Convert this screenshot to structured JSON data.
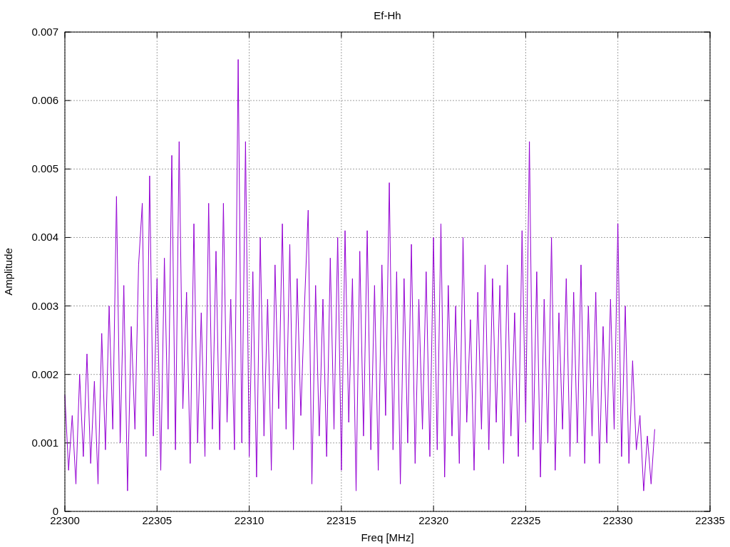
{
  "chart": {
    "chart_data": {
      "type": "line",
      "title": "Ef-Hh",
      "xlabel": "Freq [MHz]",
      "ylabel": "Amplitude",
      "grid": true,
      "xlim": [
        22300,
        22335
      ],
      "ylim": [
        0,
        0.007
      ],
      "xticks": [
        22300,
        22305,
        22310,
        22315,
        22320,
        22325,
        22330,
        22335
      ],
      "yticks": [
        {
          "value": 0,
          "label": "0"
        },
        {
          "value": 0.001,
          "label": "0.001"
        },
        {
          "value": 0.002,
          "label": "0.002"
        },
        {
          "value": 0.003,
          "label": "0.003"
        },
        {
          "value": 0.004,
          "label": "0.004"
        },
        {
          "value": 0.005,
          "label": "0.005"
        },
        {
          "value": 0.006,
          "label": "0.006"
        },
        {
          "value": 0.007,
          "label": "0.007"
        }
      ],
      "x": [
        22300,
        22300.2,
        22300.4,
        22300.6,
        22300.8,
        22301,
        22301.2,
        22301.4,
        22301.6,
        22301.8,
        22302,
        22302.2,
        22302.4,
        22302.6,
        22302.8,
        22303,
        22303.2,
        22303.4,
        22303.6,
        22303.8,
        22304,
        22304.2,
        22304.4,
        22304.6,
        22304.8,
        22305,
        22305.2,
        22305.4,
        22305.6,
        22305.8,
        22306,
        22306.2,
        22306.4,
        22306.6,
        22306.8,
        22307,
        22307.2,
        22307.4,
        22307.6,
        22307.8,
        22308,
        22308.2,
        22308.4,
        22308.6,
        22308.8,
        22309,
        22309.2,
        22309.4,
        22309.6,
        22309.8,
        22310,
        22310.2,
        22310.4,
        22310.6,
        22310.8,
        22311,
        22311.2,
        22311.4,
        22311.6,
        22311.8,
        22312,
        22312.2,
        22312.4,
        22312.6,
        22312.8,
        22313,
        22313.2,
        22313.4,
        22313.6,
        22313.8,
        22314,
        22314.2,
        22314.4,
        22314.6,
        22314.8,
        22315,
        22315.2,
        22315.4,
        22315.6,
        22315.8,
        22316,
        22316.2,
        22316.4,
        22316.6,
        22316.8,
        22317,
        22317.2,
        22317.4,
        22317.6,
        22317.8,
        22318,
        22318.2,
        22318.4,
        22318.6,
        22318.8,
        22319,
        22319.2,
        22319.4,
        22319.6,
        22319.8,
        22320,
        22320.2,
        22320.4,
        22320.6,
        22320.8,
        22321,
        22321.2,
        22321.4,
        22321.6,
        22321.8,
        22322,
        22322.2,
        22322.4,
        22322.6,
        22322.8,
        22323,
        22323.2,
        22323.4,
        22323.6,
        22323.8,
        22324,
        22324.2,
        22324.4,
        22324.6,
        22324.8,
        22325,
        22325.2,
        22325.4,
        22325.6,
        22325.8,
        22326,
        22326.2,
        22326.4,
        22326.6,
        22326.8,
        22327,
        22327.2,
        22327.4,
        22327.6,
        22327.8,
        22328,
        22328.2,
        22328.4,
        22328.6,
        22328.8,
        22329,
        22329.2,
        22329.4,
        22329.6,
        22329.8,
        22330,
        22330.2,
        22330.4,
        22330.6,
        22330.8,
        22331,
        22331.2,
        22331.4,
        22331.6,
        22331.8,
        22332
      ],
      "series": [
        {
          "color": "#9400d3",
          "values": [
            0.0017,
            0.0006,
            0.0014,
            0.0004,
            0.002,
            0.0008,
            0.0023,
            0.0007,
            0.0019,
            0.0004,
            0.0026,
            0.0009,
            0.003,
            0.0012,
            0.0046,
            0.001,
            0.0033,
            0.0003,
            0.0027,
            0.0012,
            0.0036,
            0.0045,
            0.0008,
            0.0049,
            0.0011,
            0.0034,
            0.0006,
            0.0037,
            0.0012,
            0.0052,
            0.0009,
            0.0054,
            0.0015,
            0.0032,
            0.0007,
            0.0042,
            0.001,
            0.0029,
            0.0008,
            0.0045,
            0.0012,
            0.0038,
            0.0009,
            0.0045,
            0.0013,
            0.0031,
            0.0009,
            0.0066,
            0.001,
            0.0054,
            0.0008,
            0.0035,
            0.0005,
            0.004,
            0.0011,
            0.0031,
            0.0006,
            0.0036,
            0.0015,
            0.0042,
            0.0012,
            0.0039,
            0.0009,
            0.0034,
            0.0014,
            0.003,
            0.0044,
            0.0004,
            0.0033,
            0.0011,
            0.0031,
            0.0008,
            0.0037,
            0.0012,
            0.004,
            0.0006,
            0.0041,
            0.0013,
            0.0034,
            0.0003,
            0.0038,
            0.0011,
            0.0041,
            0.0009,
            0.0033,
            0.0006,
            0.0036,
            0.0014,
            0.0048,
            0.0009,
            0.0035,
            0.0004,
            0.0034,
            0.001,
            0.0039,
            0.0007,
            0.0031,
            0.0012,
            0.0035,
            0.0008,
            0.004,
            0.0009,
            0.0042,
            0.0005,
            0.0033,
            0.0011,
            0.003,
            0.0007,
            0.004,
            0.0013,
            0.0028,
            0.0006,
            0.0032,
            0.0012,
            0.0036,
            0.0009,
            0.0034,
            0.0013,
            0.0033,
            0.0007,
            0.0036,
            0.0011,
            0.0029,
            0.0008,
            0.0041,
            0.0013,
            0.0054,
            0.0009,
            0.0035,
            0.0005,
            0.0031,
            0.001,
            0.004,
            0.0006,
            0.0029,
            0.0012,
            0.0034,
            0.0008,
            0.0032,
            0.001,
            0.0036,
            0.0007,
            0.003,
            0.0011,
            0.0032,
            0.0007,
            0.0027,
            0.001,
            0.0031,
            0.0012,
            0.0042,
            0.0008,
            0.003,
            0.0007,
            0.0022,
            0.0009,
            0.0014,
            0.0003,
            0.0011,
            0.0004,
            0.0012
          ]
        }
      ]
    }
  }
}
